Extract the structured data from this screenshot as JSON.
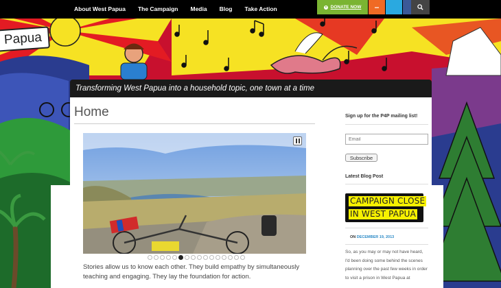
{
  "nav": {
    "items": [
      "About West Papua",
      "The Campaign",
      "Media",
      "Blog",
      "Take Action"
    ],
    "donate_label": "DONATE NOW"
  },
  "logo_text": "Papua",
  "tagline": "Transforming West Papua into a household topic, one town at a time",
  "page_title": "Home",
  "slider": {
    "dot_count": 16,
    "active_dot": 5
  },
  "intro_text": "Stories allow us to know each other. They build empathy by simultaneously teaching and engaging. They lay the foundation for action.",
  "sidebar": {
    "signup_heading": "Sign up for the P4P mailing list!",
    "email_placeholder": "Email",
    "subscribe_label": "Subscribe",
    "latest_heading": "Latest Blog Post",
    "post_title_line1": "CAMPAIGN CLOSE",
    "post_title_line2": "IN WEST PAPUA",
    "post_date_prefix": "ON",
    "post_date": "DECEMBER 19, 2013",
    "post_excerpt": "So, as you may or may not have heard, I'd been doing some behind the scenes planning over the past few weeks in order to visit a prison in West Papua at"
  },
  "colors": {
    "donate": "#7ab432",
    "rss": "#f06a24",
    "twitter": "#2aa9e0",
    "facebook": "#3b5998",
    "highlight": "#f7f100",
    "date_link": "#2b8ac6"
  }
}
